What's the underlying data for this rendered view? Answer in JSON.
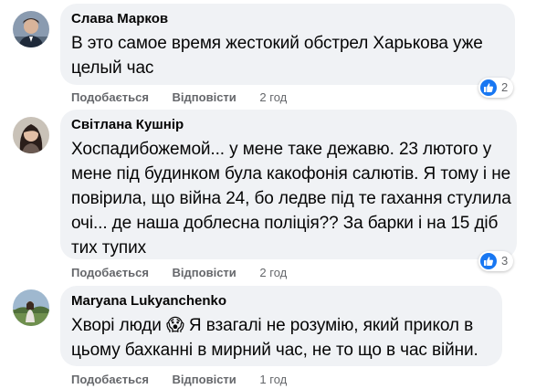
{
  "colors": {
    "bubble_bg": "#f0f2f5",
    "text": "#050505",
    "secondary_text": "#65676b",
    "like_blue": "#1877f2"
  },
  "comments": [
    {
      "author": "Слава Марков",
      "avatar_icon": "user-avatar-man-in-suit",
      "lines": [
        "В это самое время жестокий обстрел Харькова уже",
        "целый час"
      ],
      "like_label": "Подобається",
      "reply_label": "Відповісти",
      "time": "2 год",
      "reaction_icon": "like-icon",
      "reaction_count": "2"
    },
    {
      "author": "Світлана Кушнір",
      "avatar_icon": "user-avatar-woman-dark-hair",
      "lines": [
        "Хоспадибожемой... у мене таке дежавю. 23 лютого у",
        "мене під будинком була какофонія салютів. Я тому і не",
        "повірила, що війна 24, бо ледве під те гахання стулила",
        "очі... де наша доблесна поліція?? За барки і на 15 діб",
        "тих тупих"
      ],
      "like_label": "Подобається",
      "reply_label": "Відповісти",
      "time": "2 год",
      "reaction_icon": "like-icon",
      "reaction_count": "3"
    },
    {
      "author": "Maryana Lukyanchenko",
      "avatar_icon": "user-avatar-woman-outdoors",
      "lines_1_before_emoji": "Хворі люди",
      "emoji": "😱",
      "lines_1_after_emoji": "Я взагалі не розумію, який прикол в",
      "line_2": "цьому бахканні в мирний час, не то що в час війни.",
      "like_label": "Подобається",
      "reply_label": "Відповісти",
      "time": "1 год"
    }
  ]
}
